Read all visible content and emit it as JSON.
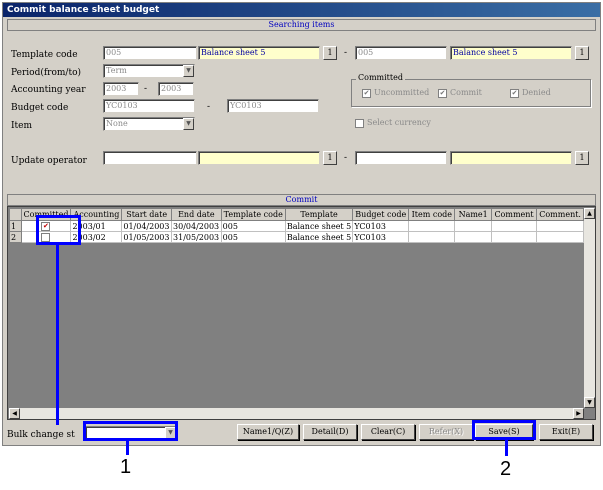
{
  "window": {
    "title": "Commit balance sheet budget"
  },
  "search": {
    "header": "Searching items",
    "template_code_label": "Template code",
    "template_code_from": "005",
    "template_name_from": "Balance sheet 5",
    "template_code_to": "005",
    "template_name_to": "Balance sheet 5",
    "period_label": "Period(from/to)",
    "period_value": "Term",
    "accounting_year_label": "Accounting year",
    "year_from": "2003",
    "year_to": "2003",
    "budget_code_label": "Budget code",
    "budget_from": "YC0103",
    "budget_to": "YC0103",
    "item_label": "Item",
    "item_value": "None",
    "update_operator_label": "Update operator",
    "lookup_label": "1",
    "dash": "-",
    "committed_group": "Committed",
    "chk_uncommitted": "Uncommitted",
    "chk_commit": "Commit",
    "chk_denied": "Denied",
    "chk_select_currency": "Select currency",
    "check_mark": "✔"
  },
  "commit": {
    "header": "Commit",
    "columns": [
      "",
      "Committed",
      "Accounting",
      "Start date",
      "End date",
      "Template code",
      "Template",
      "Budget code",
      "Item code",
      "Name1",
      "Comment",
      "Comment."
    ],
    "rows": [
      {
        "num": "1",
        "committed": true,
        "accounting": "2003/01",
        "start": "01/04/2003",
        "end": "30/04/2003",
        "tcode": "005",
        "template": "Balance sheet 5",
        "budget": "YC0103"
      },
      {
        "num": "2",
        "committed": false,
        "accounting": "2003/02",
        "start": "01/05/2003",
        "end": "31/05/2003",
        "tcode": "005",
        "template": "Balance sheet 5",
        "budget": "YC0103"
      }
    ]
  },
  "footer": {
    "bulk_label": "Bulk change st",
    "btn_name1": "Name1/Q(Z)",
    "btn_detail": "Detail(D)",
    "btn_clear": "Clear(C)",
    "btn_refer": "Refer(X)",
    "btn_save": "Save(S)",
    "btn_exit": "Exit(E)"
  },
  "callouts": {
    "one": "1",
    "two": "2"
  },
  "icons": {
    "dropdown": "chevron-down-icon",
    "scroll_up": "arrow-up-icon",
    "scroll_down": "arrow-down-icon",
    "scroll_left": "arrow-left-icon",
    "scroll_right": "arrow-right-icon"
  },
  "colors": {
    "highlight": "#0000ff",
    "title_bar": "#0a246a",
    "header_text": "#0000c0",
    "lookup_field": "#ffffcc"
  }
}
